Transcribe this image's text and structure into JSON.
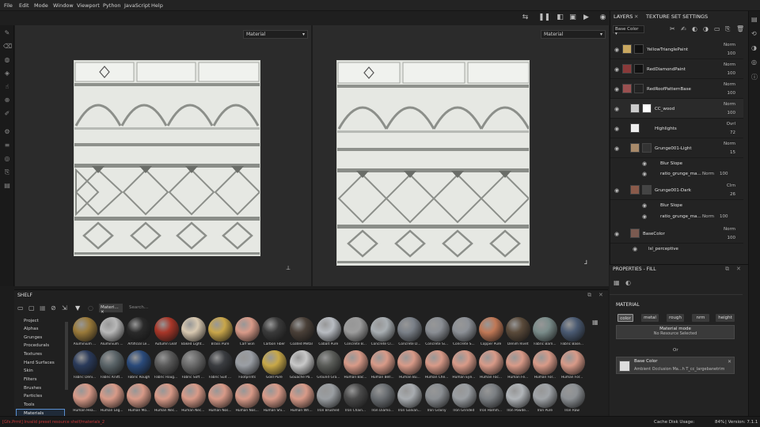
{
  "menubar": {
    "items": [
      "File",
      "Edit",
      "Mode",
      "Window",
      "Viewport",
      "Python",
      "JavaScript",
      "Help"
    ]
  },
  "viewports": {
    "left_select": "Material",
    "right_select": "Material"
  },
  "layers_panel": {
    "tabs": [
      "LAYERS",
      "TEXTURE SET SETTINGS"
    ],
    "channel_select": "Base Color",
    "layers": [
      {
        "name": "YellowTrianglePaint",
        "blend": "Norm",
        "opacity": "100"
      },
      {
        "name": "RedDiamondPaint",
        "blend": "Norm",
        "opacity": "100"
      },
      {
        "name": "RedRoofPatternBase",
        "blend": "Norm",
        "opacity": "100"
      },
      {
        "name": "CC_wood",
        "blend": "Norm",
        "opacity": "100"
      },
      {
        "name": "Highlights",
        "blend": "Ovrl",
        "opacity": "72"
      },
      {
        "name": "Grunge001-Light",
        "blend": "Norm",
        "opacity": "15"
      },
      {
        "name": "Grunge001-Dark",
        "blend": "Clrn",
        "opacity": "26"
      },
      {
        "name": "BaseColor",
        "blend": "Norm",
        "opacity": "100"
      }
    ],
    "sublayers": {
      "blur_slope": "Blur Slope",
      "ratio_grunge": "ratio_grunge_ma...",
      "ratio_blend": "Norm",
      "ratio_opacity": "100",
      "lsl": "lsl_perceptive"
    }
  },
  "properties": {
    "title": "PROPERTIES - FILL",
    "section": "MATERIAL",
    "chips": [
      "color",
      "metal",
      "rough",
      "nrm",
      "height"
    ],
    "material_mode_title": "Material mode",
    "material_mode_value": "No Resource Selected",
    "or_text": "Or",
    "base_color_title": "Base Color",
    "base_color_value": "Ambient Occlusion Ma...h T_cc_largebanetrim"
  },
  "shelf": {
    "title": "SHELF",
    "filter_tag": "Materi...",
    "search_placeholder": "Search...",
    "categories": [
      "Project",
      "Alphas",
      "Grunges",
      "Procedurals",
      "Textures",
      "Hard Surfaces",
      "Skin",
      "Filters",
      "Brushes",
      "Particles",
      "Tools",
      "Materials"
    ],
    "selected_category": "Materials",
    "materials": [
      {
        "name": "Aluminium ...",
        "color": "#9a7a3a"
      },
      {
        "name": "Aluminium ...",
        "color": "#b8b8b8"
      },
      {
        "name": "Artificial Le...",
        "color": "#2a2a2a"
      },
      {
        "name": "Autumn Leaf",
        "color": "#a83628"
      },
      {
        "name": "Baked Light...",
        "color": "#d8c8b0"
      },
      {
        "name": "Brass Pure",
        "color": "#c9a64a"
      },
      {
        "name": "Calf Skin",
        "color": "#d89a88"
      },
      {
        "name": "Carbon Fiber",
        "color": "#3a3a3a"
      },
      {
        "name": "Coated Metal",
        "color": "#4a4038"
      },
      {
        "name": "Cobalt Pure",
        "color": "#b8bcc2"
      },
      {
        "name": "Concrete B...",
        "color": "#9c9c9c"
      },
      {
        "name": "Concrete Cl...",
        "color": "#a8aeb2"
      },
      {
        "name": "Concrete D...",
        "color": "#7a8088"
      },
      {
        "name": "Concrete Si...",
        "color": "#8a8e94"
      },
      {
        "name": "Concrete S...",
        "color": "#8c9096"
      },
      {
        "name": "Copper Pure",
        "color": "#c07856"
      },
      {
        "name": "Denim Rivet",
        "color": "#5a4a3a"
      },
      {
        "name": "Fabric Barn...",
        "color": "#7a8c8a"
      },
      {
        "name": "Fabric Base...",
        "color": "#4a5a72"
      },
      {
        "name": "Fabric Deni...",
        "color": "#2a3a5a"
      },
      {
        "name": "Fabric Knitt...",
        "color": "#5a6468"
      },
      {
        "name": "Fabric Rough",
        "color": "#2a4a7a"
      },
      {
        "name": "Fabric Roug...",
        "color": "#5a5a5a"
      },
      {
        "name": "Fabric Soft ...",
        "color": "#6a6a6a"
      },
      {
        "name": "Fabric Suit ...",
        "color": "#3a3c40"
      },
      {
        "name": "Footprints",
        "color": "#9a9ea4"
      },
      {
        "name": "Gold Pure",
        "color": "#c8a848"
      },
      {
        "name": "Gouache Pa...",
        "color": "#c8c8c8"
      },
      {
        "name": "Ground Gra...",
        "color": "#5a5c58"
      },
      {
        "name": "Human Bac...",
        "color": "#d89a88"
      },
      {
        "name": "Human Bell...",
        "color": "#d89a88"
      },
      {
        "name": "Human Bu...",
        "color": "#d89a88"
      },
      {
        "name": "Human Che...",
        "color": "#d89a88"
      },
      {
        "name": "Human Eye...",
        "color": "#d89a88"
      },
      {
        "name": "Human Fac...",
        "color": "#d89a88"
      },
      {
        "name": "Human Fe...",
        "color": "#d89a88"
      },
      {
        "name": "Human For...",
        "color": "#d89a88"
      },
      {
        "name": "Human For...",
        "color": "#d89a88"
      },
      {
        "name": "Human Hea...",
        "color": "#d89a88"
      },
      {
        "name": "Human Leg...",
        "color": "#d89a88"
      },
      {
        "name": "Human Mo...",
        "color": "#d89a88"
      },
      {
        "name": "Human Nec...",
        "color": "#d89a88"
      },
      {
        "name": "Human Nec...",
        "color": "#d89a88"
      },
      {
        "name": "Human Nos...",
        "color": "#d89a88"
      },
      {
        "name": "Human Nos...",
        "color": "#d89a88"
      },
      {
        "name": "Human Shi...",
        "color": "#d89a88"
      },
      {
        "name": "Human Wri...",
        "color": "#d89a88"
      },
      {
        "name": "Iron Brushed",
        "color": "#9a9ea2"
      },
      {
        "name": "Iron Chain...",
        "color": "#4a4a4a"
      },
      {
        "name": "Iron Diamo...",
        "color": "#6a6e72"
      },
      {
        "name": "Iron Galvan...",
        "color": "#a8acb0"
      },
      {
        "name": "Iron Grainy",
        "color": "#8a8e92"
      },
      {
        "name": "Iron Grinded",
        "color": "#9a9ea2"
      },
      {
        "name": "Iron Hamm...",
        "color": "#7a7e82"
      },
      {
        "name": "Iron Powde...",
        "color": "#b0b4b8"
      },
      {
        "name": "Iron Pure",
        "color": "#a0a4a8"
      },
      {
        "name": "Iron Raw",
        "color": "#8c9094"
      }
    ]
  },
  "statusbar": {
    "left": "[Gfx.Prmt] Invalid preset resource shelf/materials_2",
    "cache": "Cache Disk Usage:",
    "cache_val": "84%",
    "version": "| Version: 7.1.1"
  }
}
